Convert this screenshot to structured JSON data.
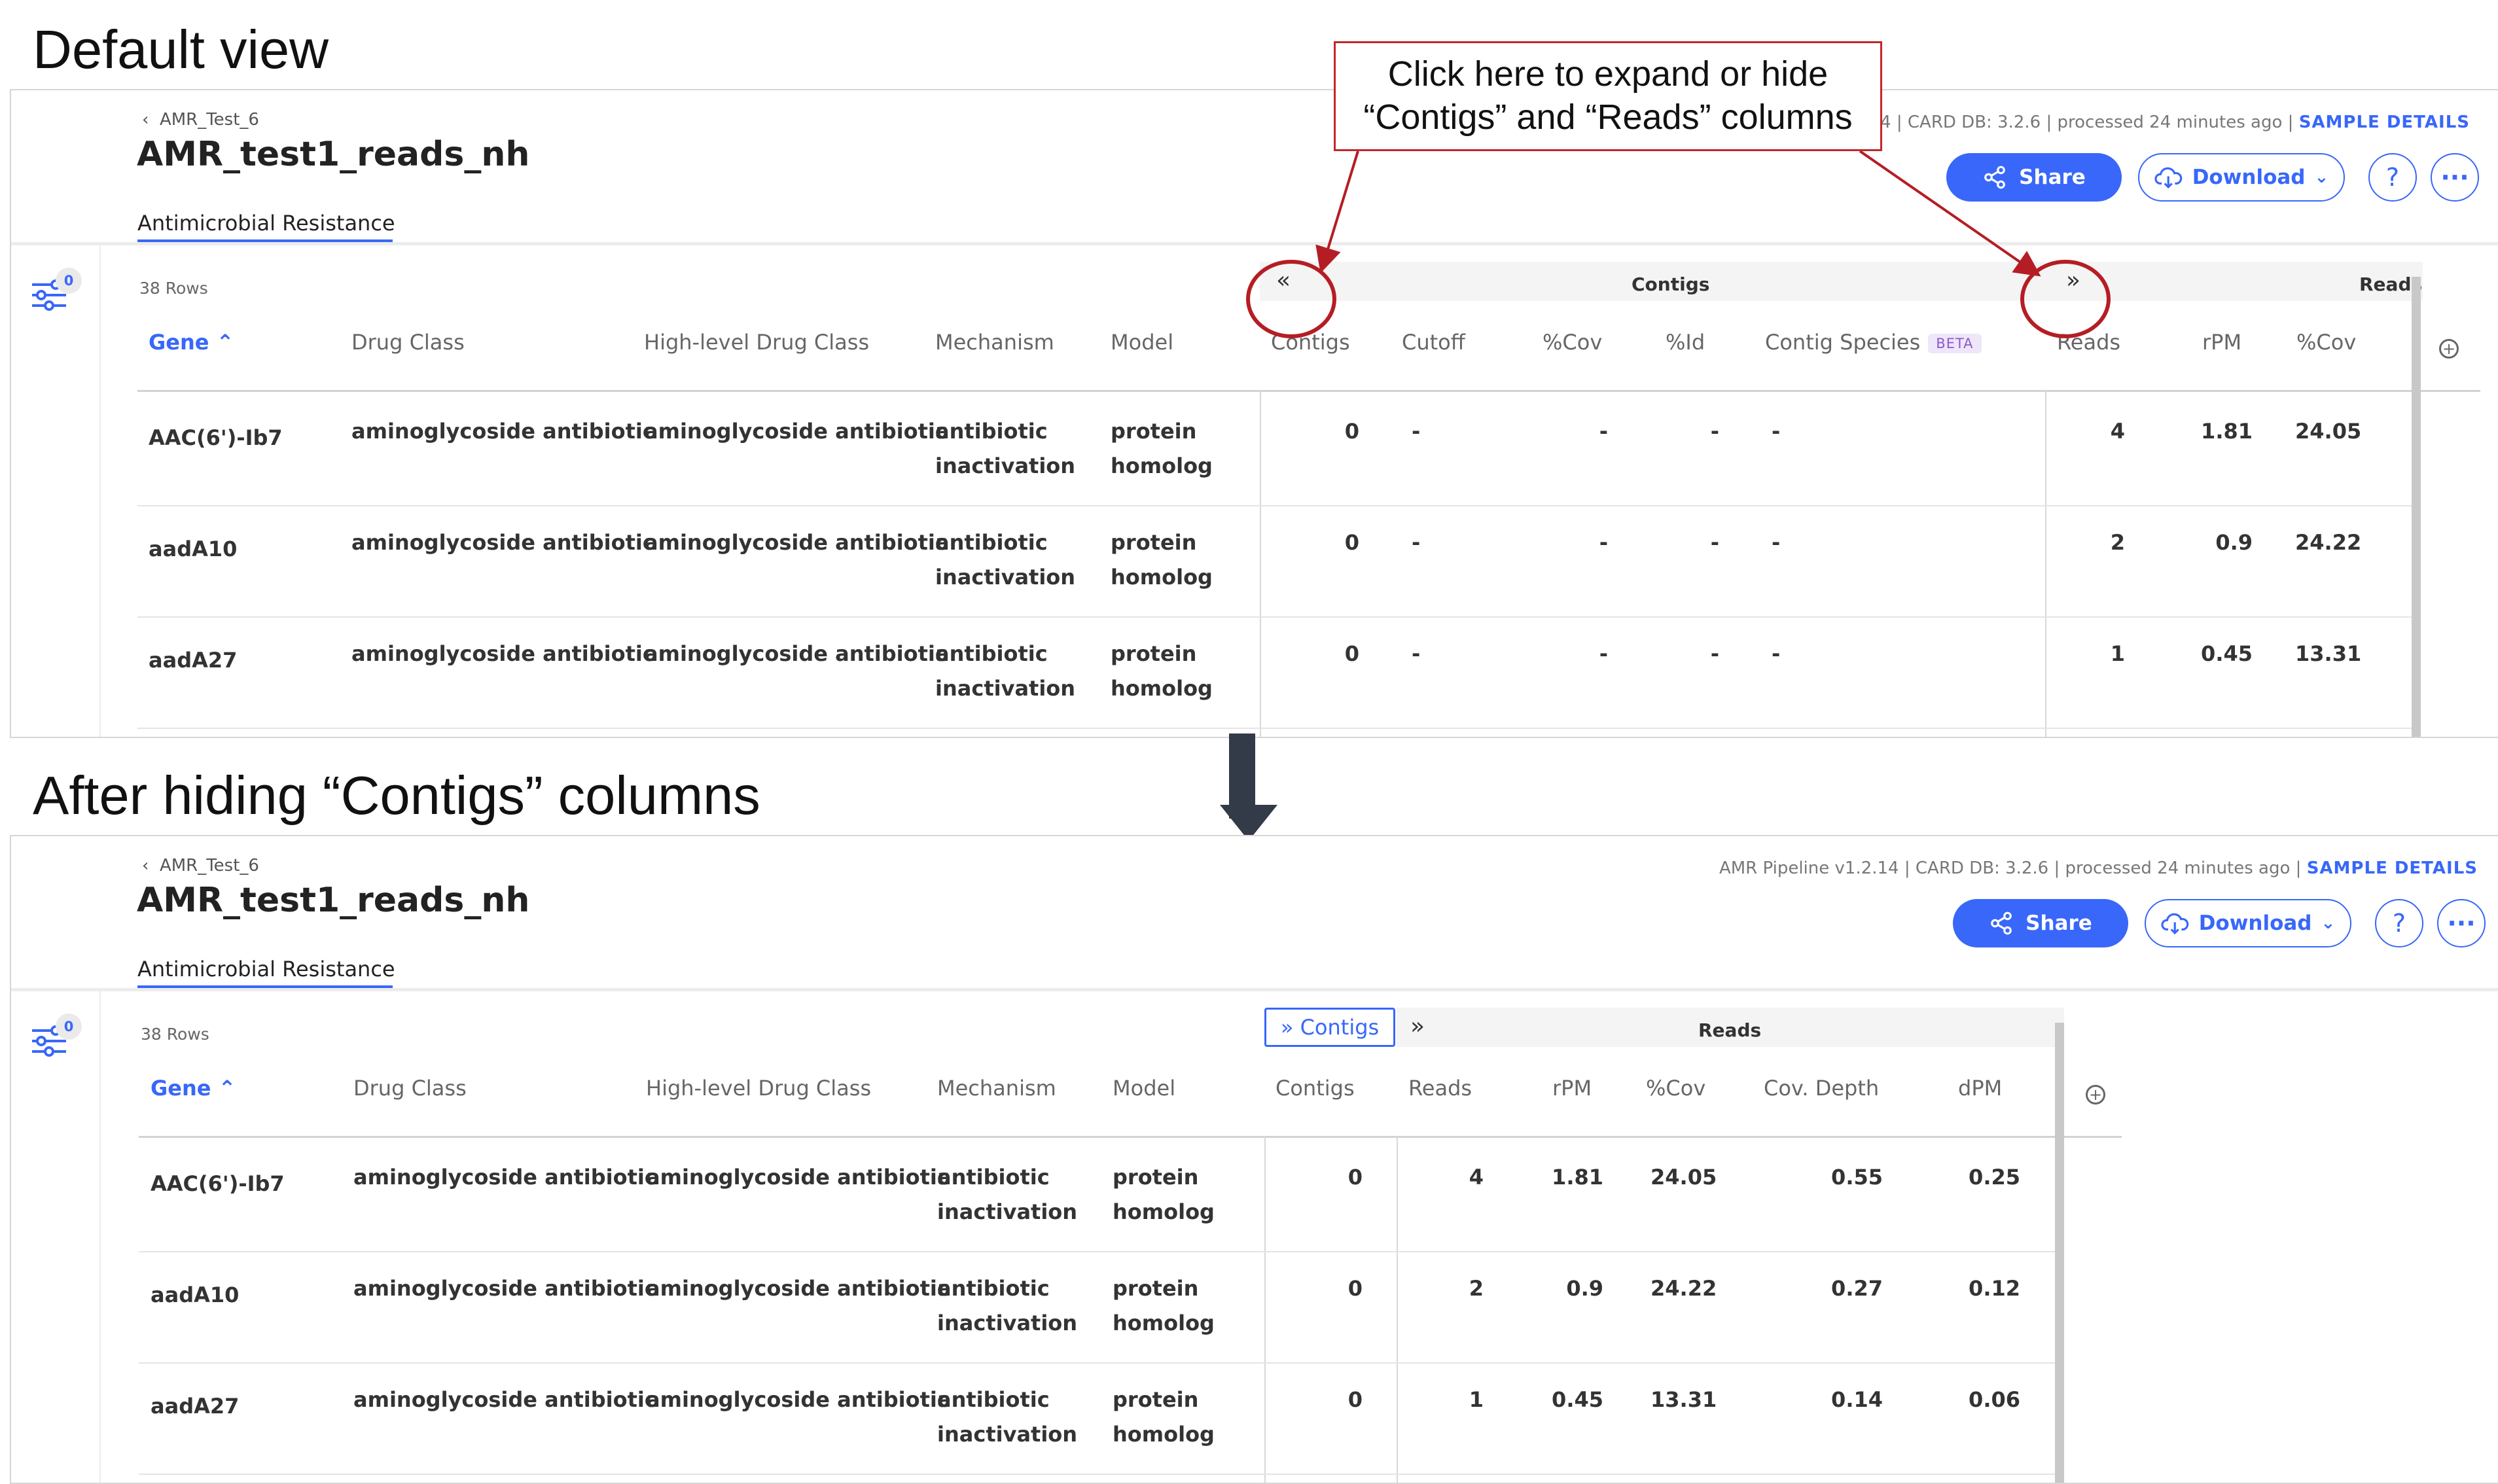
{
  "titles": {
    "top": "Default view",
    "bottom": "After hiding “Contigs” columns"
  },
  "callout": {
    "line1": "Click here to expand or hide",
    "line2": "“Contigs” and “Reads” columns"
  },
  "header": {
    "breadcrumb": "AMR_Test_6",
    "sample_name": "AMR_test1_reads_nh",
    "tab": "Antimicrobial Resistance",
    "meta_top": "v1.2.14 | CARD DB: 3.2.6 | processed 24 minutes ago |",
    "meta_bottom": "AMR Pipeline v1.2.14 | CARD DB: 3.2.6 | processed 24 minutes ago |",
    "sample_details": "SAMPLE DETAILS",
    "share": "Share",
    "download": "Download",
    "help": "?",
    "more": "···",
    "accent": "#3867fa"
  },
  "filter_count": "0",
  "rows_count": "38 Rows",
  "groups": {
    "contigs": "Contigs",
    "reads": "Reads",
    "collapse": "«",
    "expand": "»",
    "contigs_toggle": "» Contigs"
  },
  "beta": "BETA",
  "view1": {
    "columns": [
      "Gene",
      "Drug Class",
      "High-level Drug Class",
      "Mechanism",
      "Model",
      "Contigs",
      "Cutoff",
      "%Cov",
      "%Id",
      "Contig Species",
      "Reads",
      "rPM",
      "%Cov"
    ],
    "rows": [
      {
        "gene": "AAC(6')-Ib7",
        "drug": "aminoglycoside antibiotic",
        "hl": "aminoglycoside antibiotic",
        "mech1": "antibiotic",
        "mech2": "inactivation",
        "model1": "protein",
        "model2": "homolog",
        "contigs": "0",
        "cutoff": "-",
        "cov": "-",
        "id": "-",
        "species": "-",
        "reads": "4",
        "rpm": "1.81",
        "rcov": "24.05"
      },
      {
        "gene": "aadA10",
        "drug": "aminoglycoside antibiotic",
        "hl": "aminoglycoside antibiotic",
        "mech1": "antibiotic",
        "mech2": "inactivation",
        "model1": "protein",
        "model2": "homolog",
        "contigs": "0",
        "cutoff": "-",
        "cov": "-",
        "id": "-",
        "species": "-",
        "reads": "2",
        "rpm": "0.9",
        "rcov": "24.22"
      },
      {
        "gene": "aadA27",
        "drug": "aminoglycoside antibiotic",
        "hl": "aminoglycoside antibiotic",
        "mech1": "antibiotic",
        "mech2": "inactivation",
        "model1": "protein",
        "model2": "homolog",
        "contigs": "0",
        "cutoff": "-",
        "cov": "-",
        "id": "-",
        "species": "-",
        "reads": "1",
        "rpm": "0.45",
        "rcov": "13.31"
      }
    ]
  },
  "view2": {
    "columns": [
      "Gene",
      "Drug Class",
      "High-level Drug Class",
      "Mechanism",
      "Model",
      "Contigs",
      "Reads",
      "rPM",
      "%Cov",
      "Cov. Depth",
      "dPM"
    ],
    "rows": [
      {
        "gene": "AAC(6')-Ib7",
        "drug": "aminoglycoside antibiotic",
        "hl": "aminoglycoside antibiotic",
        "mech1": "antibiotic",
        "mech2": "inactivation",
        "model1": "protein",
        "model2": "homolog",
        "contigs": "0",
        "reads": "4",
        "rpm": "1.81",
        "rcov": "24.05",
        "depth": "0.55",
        "dpm": "0.25"
      },
      {
        "gene": "aadA10",
        "drug": "aminoglycoside antibiotic",
        "hl": "aminoglycoside antibiotic",
        "mech1": "antibiotic",
        "mech2": "inactivation",
        "model1": "protein",
        "model2": "homolog",
        "contigs": "0",
        "reads": "2",
        "rpm": "0.9",
        "rcov": "24.22",
        "depth": "0.27",
        "dpm": "0.12"
      },
      {
        "gene": "aadA27",
        "drug": "aminoglycoside antibiotic",
        "hl": "aminoglycoside antibiotic",
        "mech1": "antibiotic",
        "mech2": "inactivation",
        "model1": "protein",
        "model2": "homolog",
        "contigs": "0",
        "reads": "1",
        "rpm": "0.45",
        "rcov": "13.31",
        "depth": "0.14",
        "dpm": "0.06"
      }
    ]
  }
}
